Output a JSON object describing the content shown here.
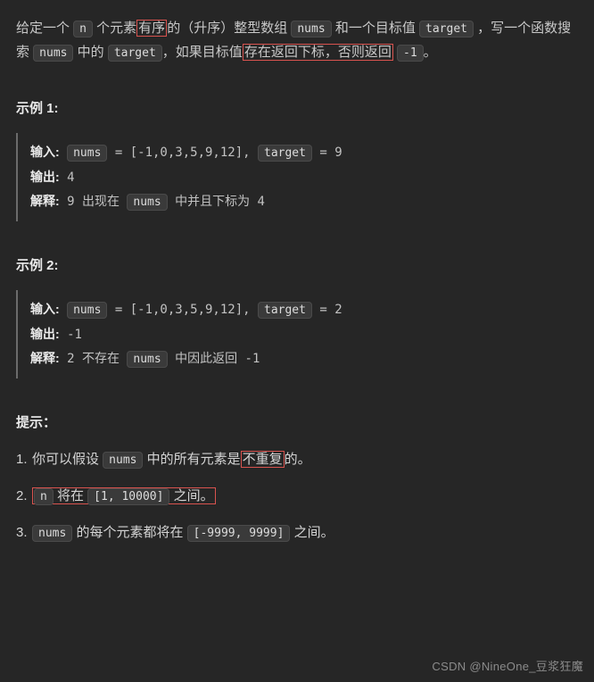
{
  "desc": {
    "p1a": "给定一个 ",
    "n": "n",
    "p1b": " 个元素",
    "p1b_red": "有序",
    "p1c": "的（升序）整型数组 ",
    "nums1": "nums",
    "p1d": " 和一个目标值 ",
    "target1": "target",
    "p1e": " ，写一个函数搜索 ",
    "nums2": "nums",
    "p1f": " 中的 ",
    "target2": "target",
    "p1g": "，如果目标值",
    "p1g_red": "存在返回下标，否则返回",
    "neg1": "-1",
    "p1h": "。"
  },
  "ex1": {
    "heading": "示例 1:",
    "in_label": "输入:",
    "in_code1": "nums",
    "in_mid": " = [-1,0,3,5,9,12], ",
    "in_code2": "target",
    "in_after": " = 9",
    "out_label": "输出:",
    "out_val": " 4",
    "exp_label": "解释:",
    "exp_a": " 9 出现在 ",
    "exp_code": "nums",
    "exp_b": " 中并且下标为 4"
  },
  "ex2": {
    "heading": "示例 2:",
    "in_label": "输入:",
    "in_code1": "nums",
    "in_mid": " = [-1,0,3,5,9,12], ",
    "in_code2": "target",
    "in_after": " = 2",
    "out_label": "输出:",
    "out_val": " -1",
    "exp_label": "解释:",
    "exp_a": " 2 不存在 ",
    "exp_code": "nums",
    "exp_b": " 中因此返回 -1"
  },
  "hints": {
    "heading": "提示：",
    "h1_a": "你可以假设 ",
    "h1_code": "nums",
    "h1_b": " 中的所有元素是",
    "h1_b_red": "不重复",
    "h1_c": "的。",
    "h2_code_n": "n",
    "h2_a": " 将在 ",
    "h2_range": "[1, 10000]",
    "h2_b": " 之间。",
    "h3_code": "nums",
    "h3_a": " 的每个元素都将在 ",
    "h3_range": "[-9999, 9999]",
    "h3_b": " 之间。"
  },
  "watermark": "CSDN @NineOne_豆浆狂魔"
}
